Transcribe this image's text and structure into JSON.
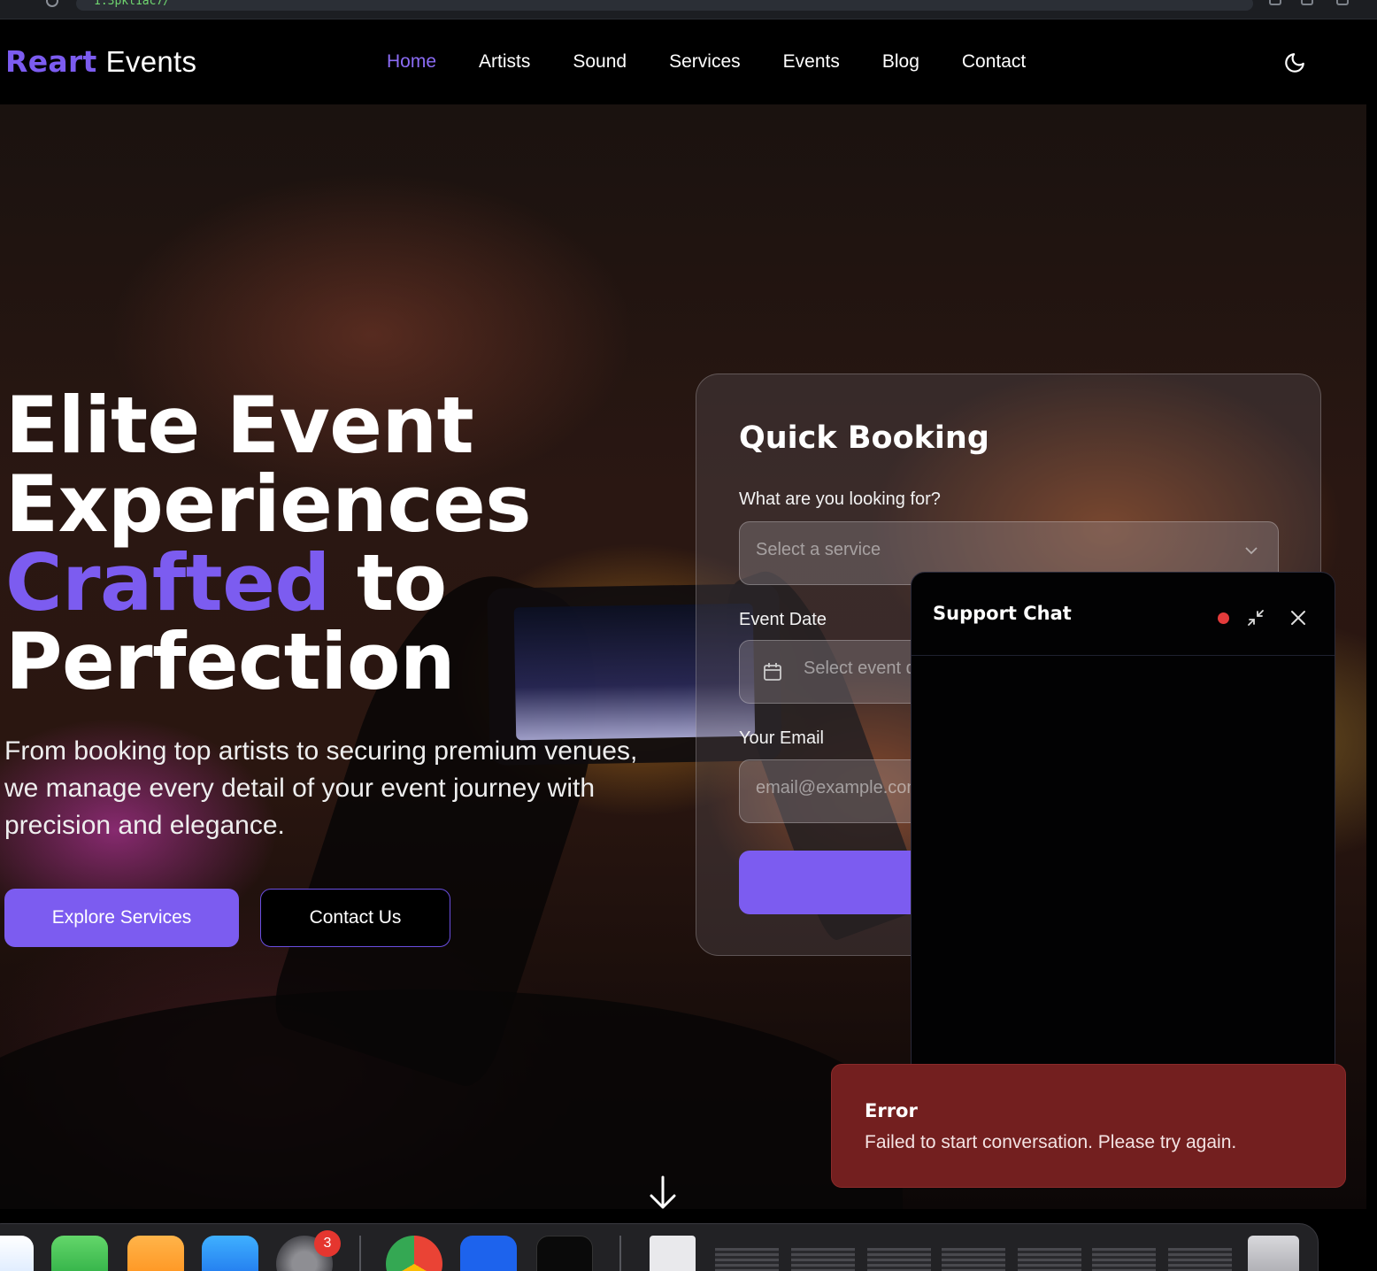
{
  "browser": {
    "url_fragment": "1:3pkl1ac7/"
  },
  "header": {
    "logo_brand": "Reart",
    "logo_suffix": "Events",
    "nav": [
      "Home",
      "Artists",
      "Sound",
      "Services",
      "Events",
      "Blog",
      "Contact"
    ],
    "active_nav": "Home",
    "theme_icon": "moon-icon"
  },
  "hero": {
    "headline_line1": "Elite Event",
    "headline_line2": "Experiences",
    "headline_accent": "Crafted",
    "headline_to": "to",
    "headline_line4": "Perfection",
    "subtext": "From booking top artists to securing premium venues, we manage every detail of your event journey with precision and elegance.",
    "primary_button": "Explore Services",
    "secondary_button": "Contact Us"
  },
  "booking": {
    "title": "Quick Booking",
    "service_label": "What are you looking for?",
    "service_placeholder": "Select a service",
    "date_label": "Event Date",
    "date_placeholder": "Select event date",
    "email_label": "Your Email",
    "email_placeholder": "email@example.com"
  },
  "chat": {
    "title": "Support Chat",
    "status_color": "#e43b3b"
  },
  "toast": {
    "title": "Error",
    "message": "Failed to start conversation. Please try again."
  },
  "dock": {
    "badge_count": "3"
  },
  "colors": {
    "accent": "#7c5cf0",
    "error_bg": "#731f1f"
  }
}
